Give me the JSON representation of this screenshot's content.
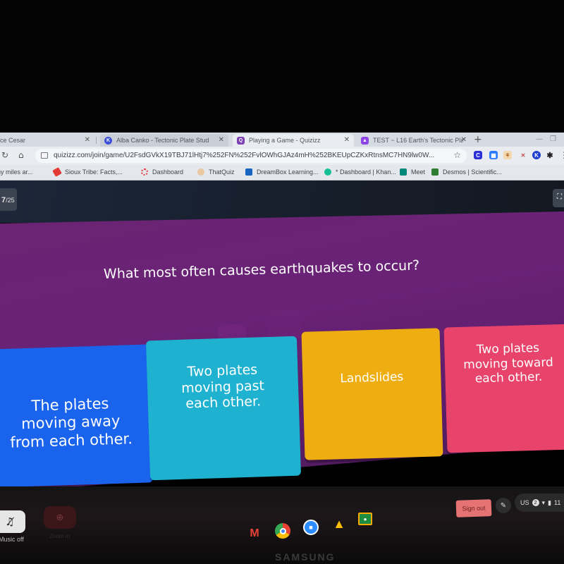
{
  "browser": {
    "tabs": [
      {
        "label": "ce Cesar",
        "favicon": "none",
        "active": false
      },
      {
        "label": "Alba Canko - Tectonic Plate Stud",
        "favicon": "k-icon",
        "active": false
      },
      {
        "label": "Playing a Game - Quizizz",
        "favicon": "quizizz-icon",
        "active": true
      },
      {
        "label": "TEST ~ L16 Earth's Tectonic Pla",
        "favicon": "classroom-icon",
        "active": false
      }
    ],
    "new_tab": "+",
    "close_glyph": "✕",
    "url": "quizizz.com/join/game/U2FsdGVkX19TBJ71lHtj7%252FN%252FvlOWhGJAz4mH%252BKEUpCZKxRtnsMC7HN9lw0W...",
    "bookmarks": [
      {
        "label": "ny miles ar...",
        "color": ""
      },
      {
        "label": "Sioux Tribe: Facts,...",
        "color": "#e53935"
      },
      {
        "label": "Dashboard",
        "color": "#e53935"
      },
      {
        "label": "ThatQuiz",
        "color": "#e8c9a0"
      },
      {
        "label": "DreamBox Learning...",
        "color": "#1565c0"
      },
      {
        "label": "* Dashboard | Khan...",
        "color": "#14bf96"
      },
      {
        "label": "Meet",
        "color": "#00897b"
      },
      {
        "label": "Desmos | Scientific...",
        "color": "#2e7d32"
      }
    ],
    "extensions": [
      {
        "label": "C",
        "color": "#2a2fd6"
      },
      {
        "label": "▦",
        "color": "#2979ff"
      },
      {
        "label": "⚘",
        "color": "#f0c080"
      },
      {
        "label": "✕",
        "color": "#d0d0d0"
      },
      {
        "label": "K",
        "color": "#1e3fd0"
      },
      {
        "label": "✱",
        "color": "#222"
      }
    ]
  },
  "quiz": {
    "counter_current": "7",
    "counter_total": "/25",
    "question": "What most often causes earthquakes to occur?",
    "options": [
      {
        "lines": [
          "The plates",
          "moving away",
          "from each other."
        ],
        "color": "#1a63ec"
      },
      {
        "lines": [
          "Two plates",
          "moving past",
          "each other."
        ],
        "color": "#1eb1d0"
      },
      {
        "lines": [
          "Landslides"
        ],
        "color": "#eeae12"
      },
      {
        "lines": [
          "Two plates",
          "moving toward",
          "each other."
        ],
        "color": "#e8436a"
      }
    ],
    "music_label": "Music off",
    "zoom_label": "Zoom in"
  },
  "shelf": {
    "apps": [
      "gmail-icon",
      "chrome-icon",
      "zoom-icon",
      "drive-icon",
      "classroom-icon"
    ],
    "sign_out": "Sign out",
    "tray": {
      "locale": "US",
      "notifications": "2",
      "time": "11"
    },
    "brand": "SAMSUNG"
  }
}
